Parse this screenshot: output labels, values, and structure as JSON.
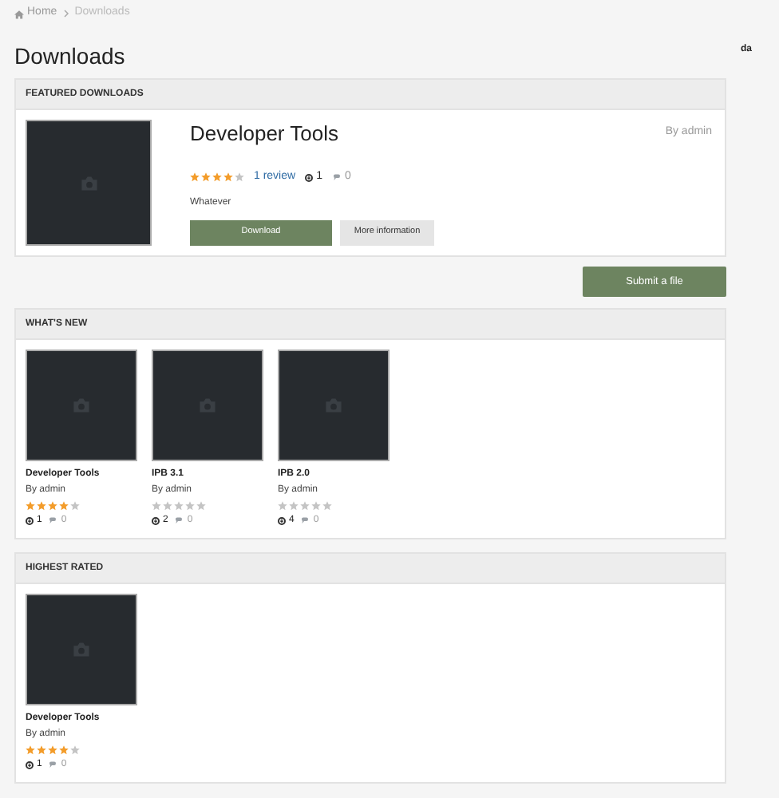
{
  "breadcrumb": [
    {
      "label": "Home",
      "kind": "home"
    },
    {
      "label": "Downloads",
      "kind": "current"
    }
  ],
  "title": "Downloads",
  "user": "da",
  "featured": {
    "heading": "FEATURED DOWNLOADS",
    "name": "Developer Tools",
    "author": "By admin",
    "stars": 4,
    "reviews": "1 review",
    "downloads": "1",
    "comments": "0",
    "description": "Whatever",
    "buttons": [
      {
        "label": "Download",
        "kind": "primary"
      },
      {
        "label": "More information",
        "kind": "secondary"
      }
    ]
  },
  "submit_button": "Submit a file",
  "sections": [
    {
      "heading": "WHAT'S NEW",
      "files": [
        {
          "name": "Developer Tools",
          "author": "By admin",
          "stars": 4,
          "downloads": "1",
          "comments": "0"
        },
        {
          "name": "IPB 3.1",
          "author": "By admin",
          "stars": 0,
          "downloads": "2",
          "comments": "0"
        },
        {
          "name": "IPB 2.0",
          "author": "By admin",
          "stars": 0,
          "downloads": "4",
          "comments": "0"
        }
      ]
    },
    {
      "heading": "HIGHEST RATED",
      "files": [
        {
          "name": "Developer Tools",
          "author": "By admin",
          "stars": 4,
          "downloads": "1",
          "comments": "0"
        }
      ]
    }
  ]
}
